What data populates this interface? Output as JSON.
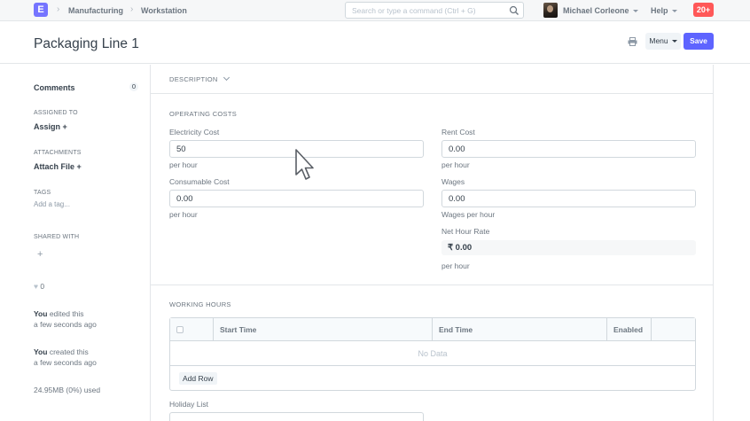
{
  "navbar": {
    "logo_letter": "E",
    "breadcrumbs": [
      "Manufacturing",
      "Workstation"
    ],
    "search_placeholder": "Search or type a command (Ctrl + G)",
    "user_name": "Michael Corleone",
    "help_label": "Help",
    "notification_count": "20+"
  },
  "page": {
    "title": "Packaging Line 1",
    "menu_label": "Menu",
    "save_label": "Save"
  },
  "sidebar": {
    "comments_label": "Comments",
    "comments_count": "0",
    "assigned_to_label": "ASSIGNED TO",
    "assign_label": "Assign",
    "attachments_label": "ATTACHMENTS",
    "attach_file_label": "Attach File",
    "tags_label": "TAGS",
    "add_tag_label": "Add a tag...",
    "shared_with_label": "SHARED WITH",
    "like_count": "0",
    "activity": [
      {
        "user": "You",
        "action": "edited this",
        "time": "a few seconds ago"
      },
      {
        "user": "You",
        "action": "created this",
        "time": "a few seconds ago"
      }
    ],
    "usage": "24.95MB (0%) used"
  },
  "form": {
    "description_section": "DESCRIPTION",
    "operating_costs_section": "OPERATING COSTS",
    "electricity_cost": {
      "label": "Electricity Cost",
      "value": "50",
      "description": "per hour"
    },
    "consumable_cost": {
      "label": "Consumable Cost",
      "value": "0.00",
      "description": "per hour"
    },
    "rent_cost": {
      "label": "Rent Cost",
      "value": "0.00",
      "description": "per hour"
    },
    "wages": {
      "label": "Wages",
      "value": "0.00",
      "description": "Wages per hour"
    },
    "net_hour_rate": {
      "label": "Net Hour Rate",
      "value": "₹ 0.00",
      "description": "per hour"
    },
    "working_hours_section": "WORKING HOURS",
    "working_hours_table": {
      "columns": [
        "Start Time",
        "End Time",
        "Enabled"
      ],
      "empty_text": "No Data",
      "add_row_label": "Add Row"
    },
    "holiday_list_label": "Holiday List"
  },
  "colors": {
    "primary": "#5e64ff",
    "logo": "#7574ff",
    "notification": "#ff5858"
  }
}
